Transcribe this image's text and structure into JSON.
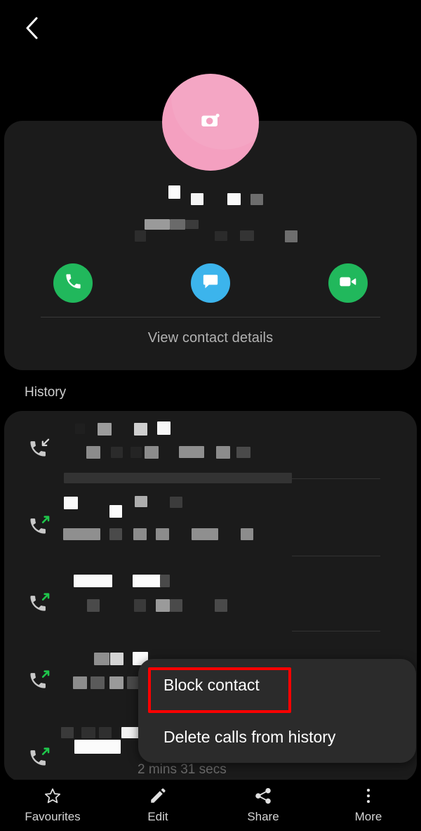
{
  "header": {
    "back_icon": "chevron-left-icon"
  },
  "contact": {
    "avatar_icon": "camera-icon",
    "avatar_color": "#f4a0c0",
    "name_redacted": true,
    "number_redacted": true,
    "view_details_label": "View contact details",
    "actions": [
      {
        "name": "call",
        "icon": "phone-icon",
        "color": "#21b85c"
      },
      {
        "name": "message",
        "icon": "message-icon",
        "color": "#3cb4ec"
      },
      {
        "name": "video-call",
        "icon": "video-camera-icon",
        "color": "#21b85c"
      }
    ]
  },
  "history": {
    "label": "History",
    "rows": [
      {
        "icon": "incoming-call-icon",
        "direction": "incoming",
        "arrow_color": "#c9c9c9",
        "redacted": true
      },
      {
        "icon": "outgoing-call-icon",
        "direction": "outgoing",
        "arrow_color": "#1fc64b",
        "redacted": true
      },
      {
        "icon": "outgoing-call-icon",
        "direction": "outgoing",
        "arrow_color": "#1fc64b",
        "redacted": true
      },
      {
        "icon": "outgoing-call-icon",
        "direction": "outgoing",
        "arrow_color": "#1fc64b",
        "redacted": true
      },
      {
        "icon": "outgoing-call-icon",
        "direction": "outgoing",
        "arrow_color": "#1fc64b",
        "redacted": true
      }
    ],
    "duration_text": "2 mins 31 secs"
  },
  "context_menu": {
    "items": [
      {
        "label": "Block contact",
        "highlighted": true
      },
      {
        "label": "Delete calls from history",
        "highlighted": false
      }
    ],
    "highlight_color": "#fe0000"
  },
  "bottom_nav": {
    "items": [
      {
        "label": "Favourites",
        "icon": "star-icon"
      },
      {
        "label": "Edit",
        "icon": "pencil-icon"
      },
      {
        "label": "Share",
        "icon": "share-icon"
      },
      {
        "label": "More",
        "icon": "more-vertical-icon"
      }
    ]
  }
}
